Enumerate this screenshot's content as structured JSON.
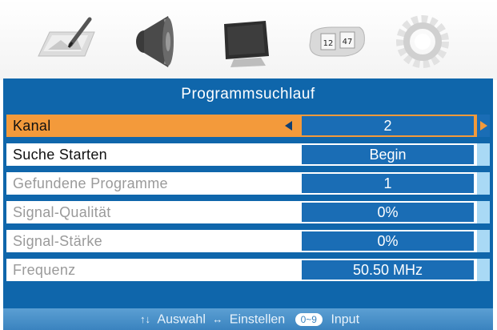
{
  "tabs": [
    {
      "icon": "picture-icon"
    },
    {
      "icon": "speaker-icon"
    },
    {
      "icon": "tv-icon"
    },
    {
      "icon": "clock-icon",
      "digits": [
        "12",
        "47"
      ]
    },
    {
      "icon": "settings-gear-icon"
    }
  ],
  "menu": {
    "title": "Programmsuchlauf",
    "rows": [
      {
        "label": "Kanal",
        "value": "2"
      },
      {
        "label": "Suche Starten",
        "value": "Begin"
      },
      {
        "label": "Gefundene Programme",
        "value": "1"
      },
      {
        "label": "Signal-Qualität",
        "value": "0%"
      },
      {
        "label": "Signal-Stärke",
        "value": "0%"
      },
      {
        "label": "Frequenz",
        "value": "50.50 MHz"
      }
    ]
  },
  "footer": {
    "up_down_keys": "↑↓",
    "select": "Auswahl",
    "left_right_keys": "↔",
    "adjust": "Einstellen",
    "number_keys": "0~9",
    "input": "Input"
  },
  "colors": {
    "panel_blue": "#0f66ab",
    "selected_orange": "#f39a3b",
    "value_blue": "#1a6db5"
  }
}
